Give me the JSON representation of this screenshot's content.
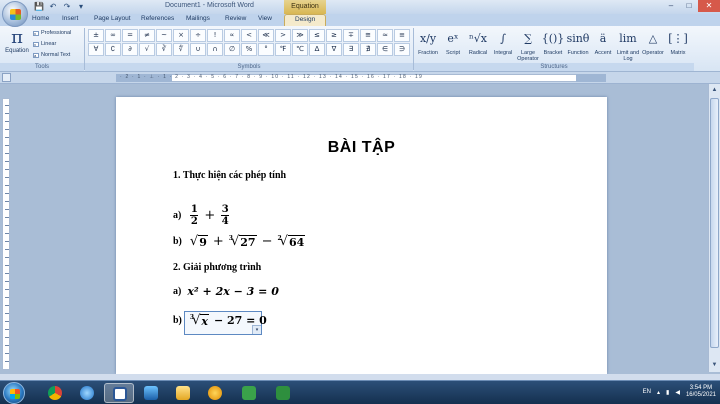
{
  "window": {
    "title": "Document1 - Microsoft Word",
    "context_tab_title": "Equation Tools",
    "controls": [
      "–",
      "□",
      "✕"
    ]
  },
  "quick_access": [
    "💾",
    "↶",
    "↷",
    "▾"
  ],
  "tabs": [
    "Home",
    "Insert",
    "Page Layout",
    "References",
    "Mailings",
    "Review",
    "View",
    "Design"
  ],
  "ribbon": {
    "tools": {
      "equation_label": "Equation",
      "equation_icon": "π",
      "options": [
        "Professional",
        "Linear",
        "Normal Text"
      ],
      "group_label": "Tools"
    },
    "symbols": {
      "group_label": "Symbols",
      "items": [
        "±",
        "∞",
        "=",
        "≠",
        "~",
        "×",
        "÷",
        "!",
        "∝",
        "<",
        "≪",
        ">",
        "≫",
        "≤",
        "≥",
        "∓",
        "≅",
        "≈",
        "≡",
        "∀",
        "∁",
        "∂",
        "√",
        "∛",
        "∜",
        "∪",
        "∩",
        "∅",
        "%",
        "°",
        "℉",
        "℃",
        "∆",
        "∇",
        "∃",
        "∄",
        "∈",
        "∋"
      ]
    },
    "structures": {
      "group_label": "Structures",
      "items": [
        {
          "icon": "x/y",
          "label": "Fraction"
        },
        {
          "icon": "eˣ",
          "label": "Script"
        },
        {
          "icon": "ⁿ√x",
          "label": "Radical"
        },
        {
          "icon": "∫",
          "label": "Integral"
        },
        {
          "icon": "∑",
          "label": "Large Operator"
        },
        {
          "icon": "{()}",
          "label": "Bracket"
        },
        {
          "icon": "sinθ",
          "label": "Function"
        },
        {
          "icon": "ä",
          "label": "Accent"
        },
        {
          "icon": "lim",
          "label": "Limit and Log"
        },
        {
          "icon": "△",
          "label": "Operator"
        },
        {
          "icon": "[⋮]",
          "label": "Matrix"
        }
      ]
    }
  },
  "ruler": {
    "numbers": "· 2 · 1 · ⊥ · 1 · 2 · 3 · 4 · 5 · 6 · 7 · 8 · 9 · 10 · 11 · 12 · 13 · 14 · 15 · 16 · 17 · 18 · 19"
  },
  "document": {
    "title": "BÀI TẬP",
    "section1": "1. Thực hiện các phép tính",
    "item_a_label": "a)",
    "frac1": {
      "num": "1",
      "den": "2"
    },
    "plus": "+",
    "frac2": {
      "num": "3",
      "den": "4"
    },
    "item_b_label": "b)",
    "sqrt9": "9",
    "cbrt_index": "3",
    "cbrt27": "27",
    "minus": "−",
    "sq_index": "2",
    "sqrt64": "64",
    "section2": "2. Giải phương trình",
    "eq_a_label": "a)",
    "eq_a": "x² + 2x − 3 = 0",
    "eq_b_label": "b)",
    "eq_b_index": "3",
    "eq_b_radicand": "x",
    "eq_b_rest": "− 27 = 0"
  },
  "taskbar": {
    "language": "EN",
    "time": "3:54 PM",
    "date": "16/05/2021"
  }
}
